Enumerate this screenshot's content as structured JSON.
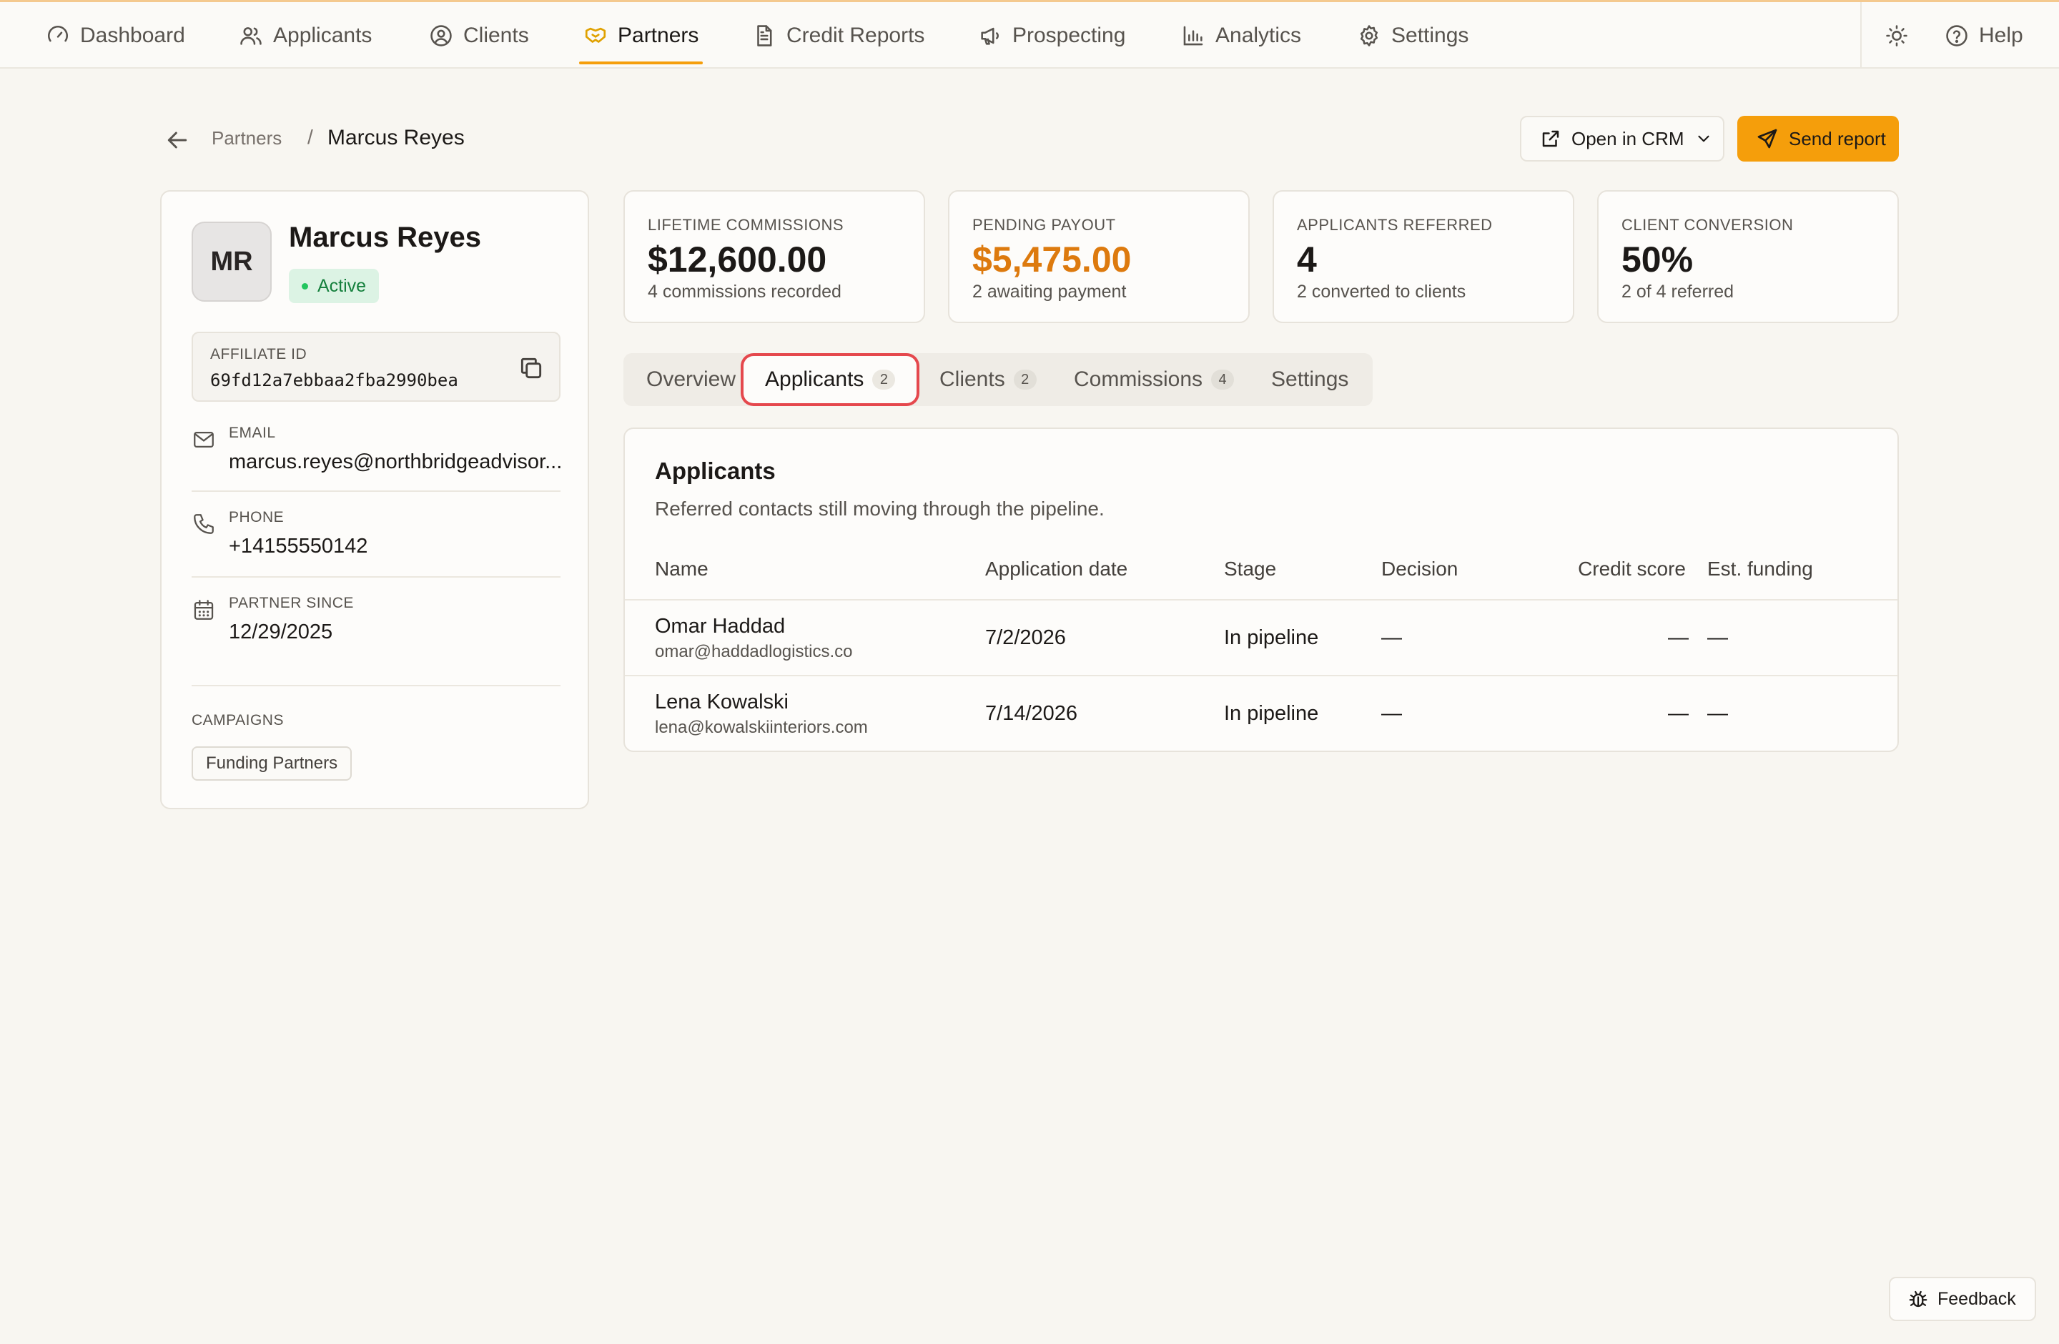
{
  "nav": {
    "items": [
      {
        "label": "Dashboard",
        "icon": "gauge-icon"
      },
      {
        "label": "Applicants",
        "icon": "users-icon"
      },
      {
        "label": "Clients",
        "icon": "user-circle-icon"
      },
      {
        "label": "Partners",
        "icon": "handshake-icon",
        "active": true
      },
      {
        "label": "Credit Reports",
        "icon": "file-text-icon"
      },
      {
        "label": "Prospecting",
        "icon": "megaphone-icon"
      },
      {
        "label": "Analytics",
        "icon": "bar-chart-icon"
      },
      {
        "label": "Settings",
        "icon": "gear-icon"
      }
    ],
    "theme_icon": "sun-icon",
    "help_label": "Help"
  },
  "breadcrumb": {
    "parent": "Partners",
    "separator": "/",
    "current": "Marcus Reyes"
  },
  "actions": {
    "open_crm": "Open in CRM",
    "send_report": "Send report"
  },
  "profile": {
    "initials": "MR",
    "name": "Marcus Reyes",
    "status": "Active",
    "affiliate_label": "AFFILIATE ID",
    "affiliate_id": "69fd12a7ebbaa2fba2990bea",
    "email_label": "EMAIL",
    "email": "marcus.reyes@northbridgeadvisor...",
    "phone_label": "PHONE",
    "phone": "+14155550142",
    "since_label": "PARTNER SINCE",
    "since": "12/29/2025",
    "campaigns_label": "CAMPAIGNS",
    "campaign": "Funding Partners"
  },
  "stats": [
    {
      "label": "LIFETIME COMMISSIONS",
      "value": "$12,600.00",
      "sub": "4 commissions recorded"
    },
    {
      "label": "PENDING PAYOUT",
      "value": "$5,475.00",
      "sub": "2 awaiting payment",
      "accent": "#dd7a0e"
    },
    {
      "label": "APPLICANTS REFERRED",
      "value": "4",
      "sub": "2 converted to clients"
    },
    {
      "label": "CLIENT CONVERSION",
      "value": "50%",
      "sub": "2 of 4 referred"
    }
  ],
  "tabs": [
    {
      "label": "Overview"
    },
    {
      "label": "Applicants",
      "count": "2",
      "active": true
    },
    {
      "label": "Clients",
      "count": "2"
    },
    {
      "label": "Commissions",
      "count": "4"
    },
    {
      "label": "Settings"
    }
  ],
  "panel": {
    "title": "Applicants",
    "subtitle": "Referred contacts still moving through the pipeline.",
    "columns": [
      "Name",
      "Application date",
      "Stage",
      "Decision",
      "Credit score",
      "Est. funding"
    ],
    "rows": [
      {
        "name": "Omar Haddad",
        "email": "omar@haddadlogistics.co",
        "date": "7/2/2026",
        "stage": "In pipeline",
        "decision": "—",
        "credit": "—",
        "funding": "—"
      },
      {
        "name": "Lena Kowalski",
        "email": "lena@kowalskiinteriors.com",
        "date": "7/14/2026",
        "stage": "In pipeline",
        "decision": "—",
        "credit": "—",
        "funding": "—"
      }
    ]
  },
  "feedback": {
    "label": "Feedback",
    "icon": "bug-icon"
  },
  "colors": {
    "accent": "#f59e0b",
    "pending": "#dd7a0e",
    "active_status": "#15803d",
    "focus_ring": "#e5484d"
  }
}
